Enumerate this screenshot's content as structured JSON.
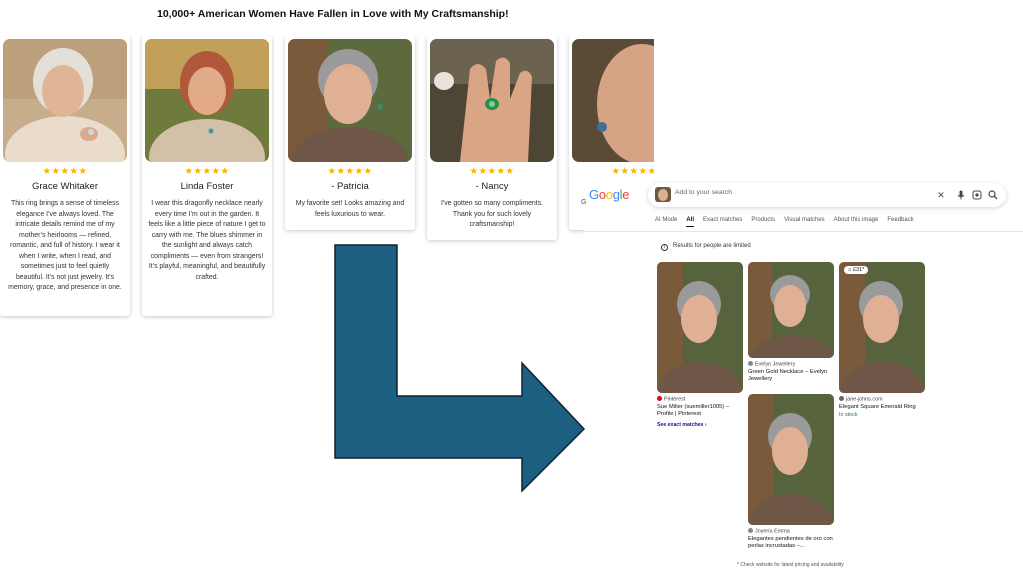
{
  "headline": "10,000+ American Women Have Fallen in Love with My Craftsmanship!",
  "colors": {
    "star": "#f4b400",
    "arrow": "#1c5f80",
    "arrow_stroke": "#0f2230",
    "stock": "#188038"
  },
  "reviews": [
    {
      "stars": "★★★★★",
      "name": "Grace Whitaker",
      "text": "This ring brings a sense of timeless elegance I’ve always loved. The intricate details remind me of my mother’s heirlooms — refined, romantic, and full of history. I wear it when I write, when I read, and sometimes just to feel quietly beautiful. It’s not just jewelry. It’s memory, grace, and presence in one."
    },
    {
      "stars": "★★★★★",
      "name": "Linda Foster",
      "text": "I wear this dragonfly necklace nearly every time I’m out in the garden. It feels like a little piece of nature I get to carry with me. The blues shimmer in the sunlight and always catch compliments — even from strangers! It’s playful, meaningful, and beautifully crafted."
    },
    {
      "stars": "★★★★★",
      "name": "- Patricia",
      "text": "My favorite set! Looks amazing and feels luxurious to wear."
    },
    {
      "stars": "★★★★★",
      "name": "- Nancy",
      "text": "I've gotten so many compliments. Thank you for such lovely craftsmanship!"
    },
    {
      "stars": "★★★★★",
      "name": "",
      "text": ""
    }
  ],
  "lens": {
    "logo": "Google",
    "cut_letter": "G",
    "search_placeholder": "Add to your search",
    "icons": [
      "close-icon",
      "mic-icon",
      "lens-icon",
      "search-icon"
    ],
    "tabs": [
      "AI Mode",
      "All",
      "Exact matches",
      "Products",
      "Visual matches",
      "About this image",
      "Feedback"
    ],
    "active_tab": "All",
    "notice": "Results for people are limited",
    "results": [
      {
        "source": "Pinterest",
        "title": "Sue Miller (suemiller1005) – Profile | Pinterest",
        "exact": "See exact matches",
        "source_color": "#e60023"
      },
      {
        "source": "Evelyn Jewellery",
        "title": "Green Gold Necklace – Evelyn Jewellery",
        "source_color": "#888888"
      },
      {
        "source": "jane-johns.com",
        "title": "Elegant Square Emerald Ring",
        "stock": "In stock",
        "price": "£31*",
        "source_color": "#666666"
      },
      {
        "source": "Joyería Emma",
        "title": "Elegantes pendientes de oro con perlas incrustadas –...",
        "source_color": "#888888"
      }
    ],
    "footnote": "* Check website for latest pricing and availability"
  }
}
